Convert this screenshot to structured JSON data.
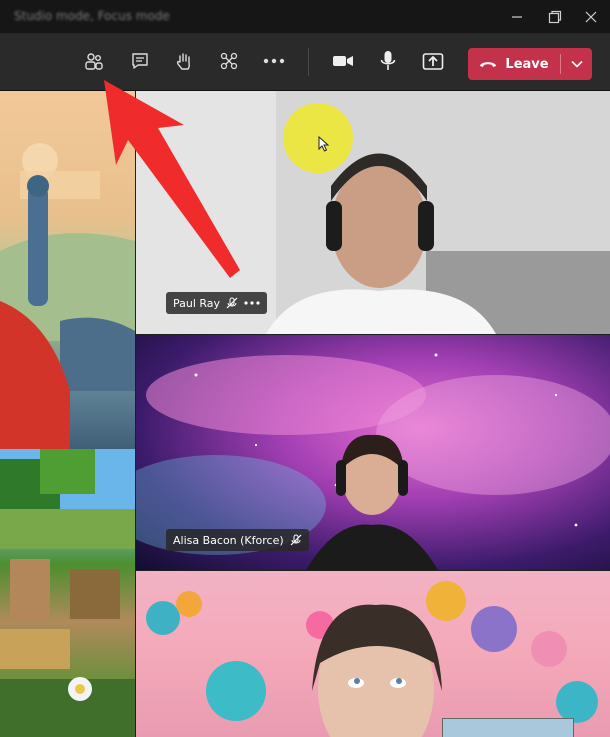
{
  "titlebar": {
    "title": "Studio mode, Focus mode",
    "controls": [
      "minimize-icon",
      "restore-icon",
      "close-icon"
    ]
  },
  "toolbar": {
    "buttons": [
      "people-icon",
      "chat-icon",
      "raise-hand-icon",
      "apps-icon",
      "more-options-icon",
      "camera-icon",
      "microphone-icon",
      "share-screen-icon"
    ],
    "leave_label": "Leave",
    "leave_color": "#c4314b"
  },
  "participants": [
    {
      "name": "Paul Ray",
      "muted": true
    },
    {
      "name": "Alisa Bacon (Kforce)",
      "muted": true
    }
  ],
  "colors": {
    "background": "#1f1f1f",
    "toolbar": "#2a2a2a",
    "annotation_arrow": "#f02b2b",
    "cursor_highlight": "#eee830"
  }
}
